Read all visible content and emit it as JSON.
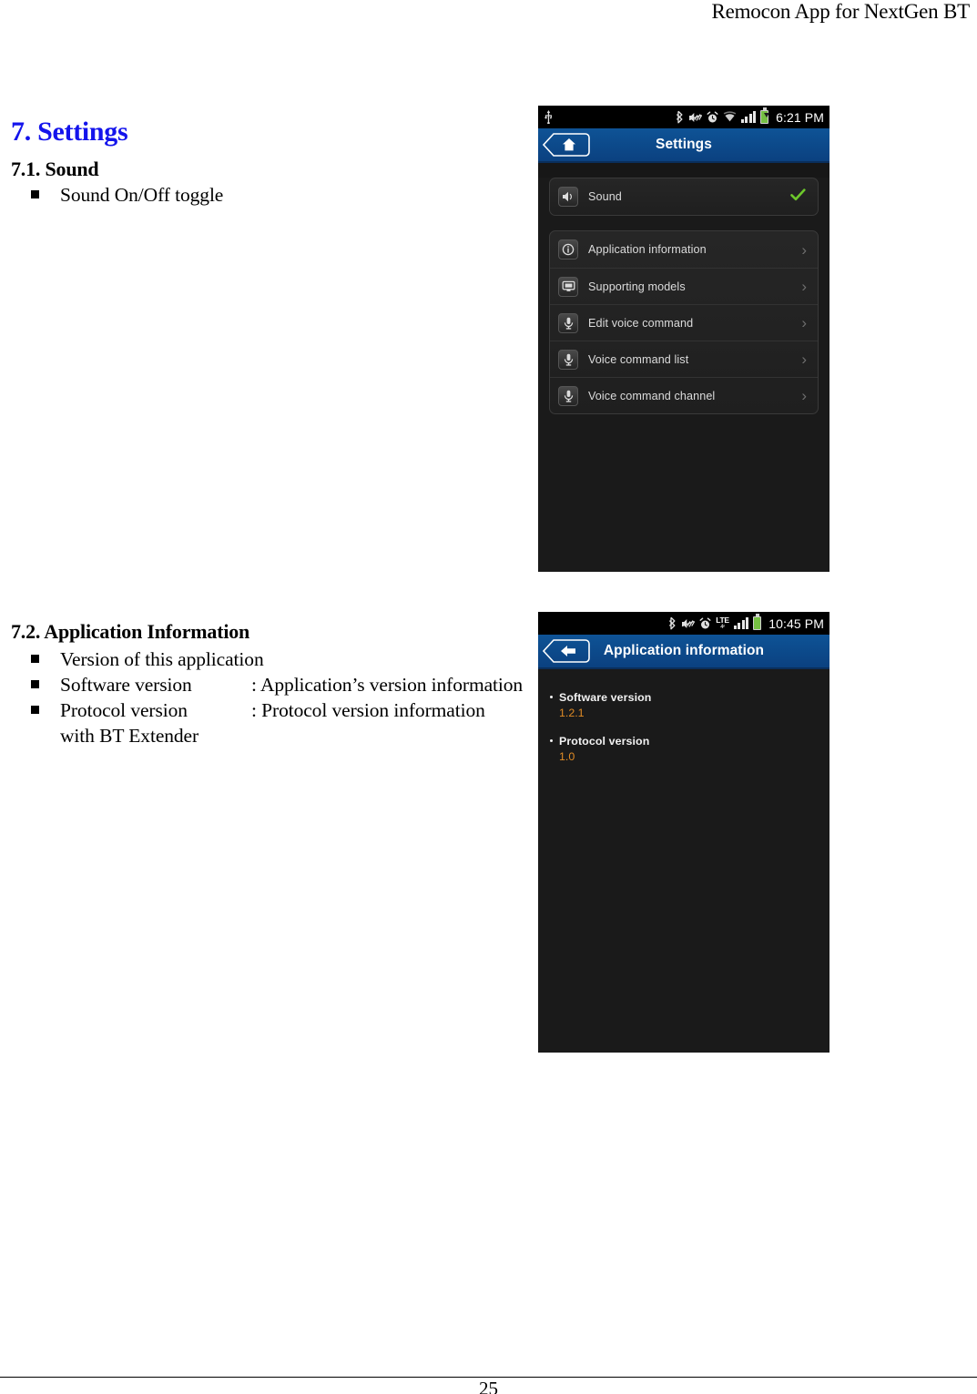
{
  "document": {
    "running_header": "Remocon App for NextGen BT",
    "page_number": "25",
    "heading_1": "7. Settings",
    "heading_1_color": "#1414ec",
    "section_sound": {
      "heading": "7.1. Sound",
      "bullets": [
        {
          "label": "Sound On/Off toggle",
          "desc": ""
        }
      ]
    },
    "section_app_info": {
      "heading": "7.2. Application Information",
      "bullets": [
        {
          "label": "Version of this application",
          "desc": ""
        },
        {
          "label": "Software version",
          "desc": ": Application’s version information"
        },
        {
          "label": "Protocol version",
          "desc": ": Protocol version information"
        }
      ],
      "continuation": "with BT Extender"
    }
  },
  "screenshot_settings": {
    "status_bar": {
      "usb_icon": "usb-icon",
      "icons": [
        "bluetooth-icon",
        "mute-icon",
        "alarm-icon",
        "wifi-icon",
        "signal-icon",
        "battery-charging-icon"
      ],
      "time": "6:21 PM"
    },
    "title_bar": {
      "nav_icon": "home-icon",
      "title": "Settings",
      "accent": "#0d4b8c"
    },
    "groups": [
      {
        "rows": [
          {
            "icon": "speaker-icon",
            "label": "Sound",
            "accessory": "checkmark",
            "accessory_color": "#6dc72b"
          }
        ]
      },
      {
        "rows": [
          {
            "icon": "info-icon",
            "label": "Application information",
            "accessory": "chevron"
          },
          {
            "icon": "monitor-icon",
            "label": "Supporting models",
            "accessory": "chevron"
          },
          {
            "icon": "microphone-icon",
            "label": "Edit voice command",
            "accessory": "chevron"
          },
          {
            "icon": "microphone-icon",
            "label": "Voice command list",
            "accessory": "chevron"
          },
          {
            "icon": "microphone-icon",
            "label": "Voice command channel",
            "accessory": "chevron"
          }
        ]
      }
    ]
  },
  "screenshot_app_info": {
    "status_bar": {
      "icons": [
        "bluetooth-icon",
        "mute-icon",
        "alarm-icon",
        "lte-icon",
        "signal-icon",
        "battery-icon"
      ],
      "lte_main": "LTE",
      "lte_sub": "4ⁿ",
      "time": "10:45 PM"
    },
    "title_bar": {
      "nav_icon": "back-arrow-icon",
      "title": "Application information",
      "accent": "#0d4b8c"
    },
    "items": [
      {
        "label": "Software version",
        "value": "1.2.1"
      },
      {
        "label": "Protocol version",
        "value": "1.0"
      }
    ],
    "value_color": "#e08b25"
  }
}
